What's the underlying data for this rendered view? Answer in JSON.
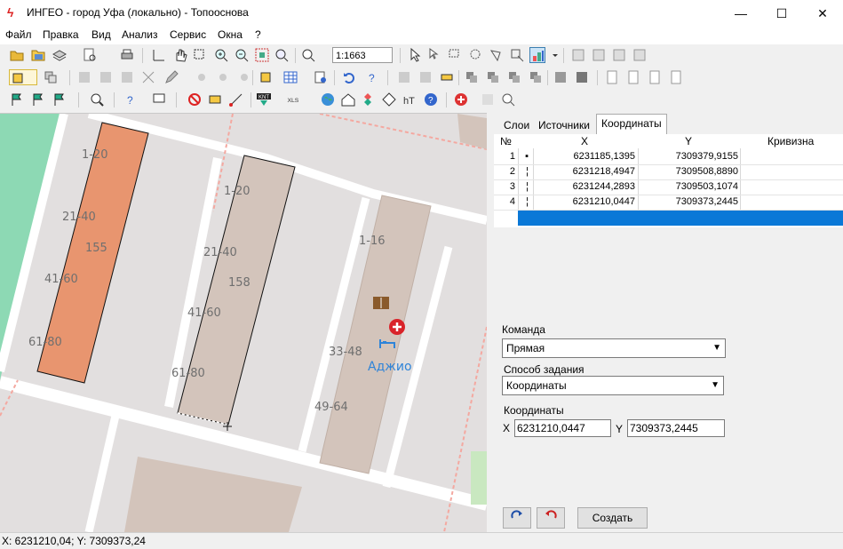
{
  "window": {
    "title": "ИНГЕО - город Уфа (локально) - Топооснова",
    "minimize": "—",
    "maximize": "☐",
    "close": "✕"
  },
  "menu": [
    "Файл",
    "Правка",
    "Вид",
    "Анализ",
    "Сервис",
    "Окна",
    "?"
  ],
  "toolbar": {
    "scale": "1:1663",
    "xls_label": "XLS",
    "knt_label": "KNT"
  },
  "map": {
    "labels": [
      {
        "text": "1-20"
      },
      {
        "text": "21-40"
      },
      {
        "text": "155"
      },
      {
        "text": "41-60"
      },
      {
        "text": "61-80"
      },
      {
        "text": "1-20"
      },
      {
        "text": "21-40"
      },
      {
        "text": "158"
      },
      {
        "text": "41-60"
      },
      {
        "text": "61-80"
      },
      {
        "text": "1-16"
      },
      {
        "text": "33-48"
      },
      {
        "text": "49-64"
      }
    ],
    "poi_label": "Аджио"
  },
  "panel": {
    "tabs": [
      "Слои",
      "Источники",
      "Координаты"
    ],
    "active_tab": "Координаты",
    "grid": {
      "columns": [
        "№",
        "X",
        "Y",
        "Кривизна"
      ],
      "rows": [
        {
          "n": "1",
          "x": "6231185,1395",
          "y": "7309379,9155",
          "k": ""
        },
        {
          "n": "2",
          "x": "6231218,4947",
          "y": "7309508,8890",
          "k": ""
        },
        {
          "n": "3",
          "x": "6231244,2893",
          "y": "7309503,1074",
          "k": ""
        },
        {
          "n": "4",
          "x": "6231210,0447",
          "y": "7309373,2445",
          "k": ""
        }
      ]
    },
    "command_label": "Команда",
    "command_value": "Прямая",
    "method_label": "Способ задания",
    "method_value": "Координаты",
    "coords_label": "Координаты",
    "x_label": "X",
    "x_value": "6231210,0447",
    "y_label": "Y",
    "y_value": "7309373,2445",
    "create_button": "Создать"
  },
  "status": {
    "coords": "X: 6231210,04; Y: 7309373,24"
  },
  "colors": {
    "selection": "#0a78d7",
    "building_orange": "#e8956f",
    "building_gray": "#d3c4bb",
    "road": "#ffffff",
    "grass": "#8dd9b4"
  }
}
